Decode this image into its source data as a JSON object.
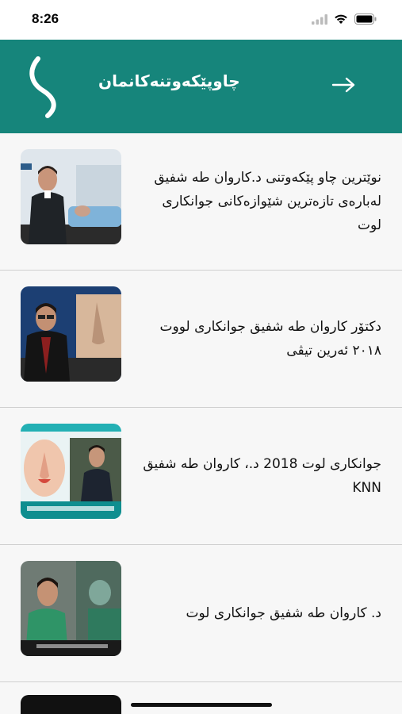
{
  "status": {
    "time": "8:26"
  },
  "header": {
    "title": "چاوپێکەوتنەکانمان"
  },
  "items": [
    {
      "title": "نوێترین چاو پێکەوتنی د.کاروان طه شفیق لەبارەی تازەترین شێوازەکانی جوانکاری لوت"
    },
    {
      "title": "دکتۆر کاروان طه شفیق جوانکاری لووت ٢٠١٨ ئەرین تیڤی"
    },
    {
      "title": "جوانکاری لوت 2018 د.، کاروان طه شفیق KNN"
    },
    {
      "title": "د. کاروان طه شفیق جوانکاری لوت"
    }
  ],
  "colors": {
    "header": "#16857b",
    "background": "#f7f7f7",
    "divider": "#cfcfcf"
  },
  "icons": {
    "back": "arrow-right-icon",
    "logo": "s-curve-logo",
    "wifi": "wifi-icon",
    "battery": "battery-icon",
    "signal": "cellular-signal-icon"
  }
}
